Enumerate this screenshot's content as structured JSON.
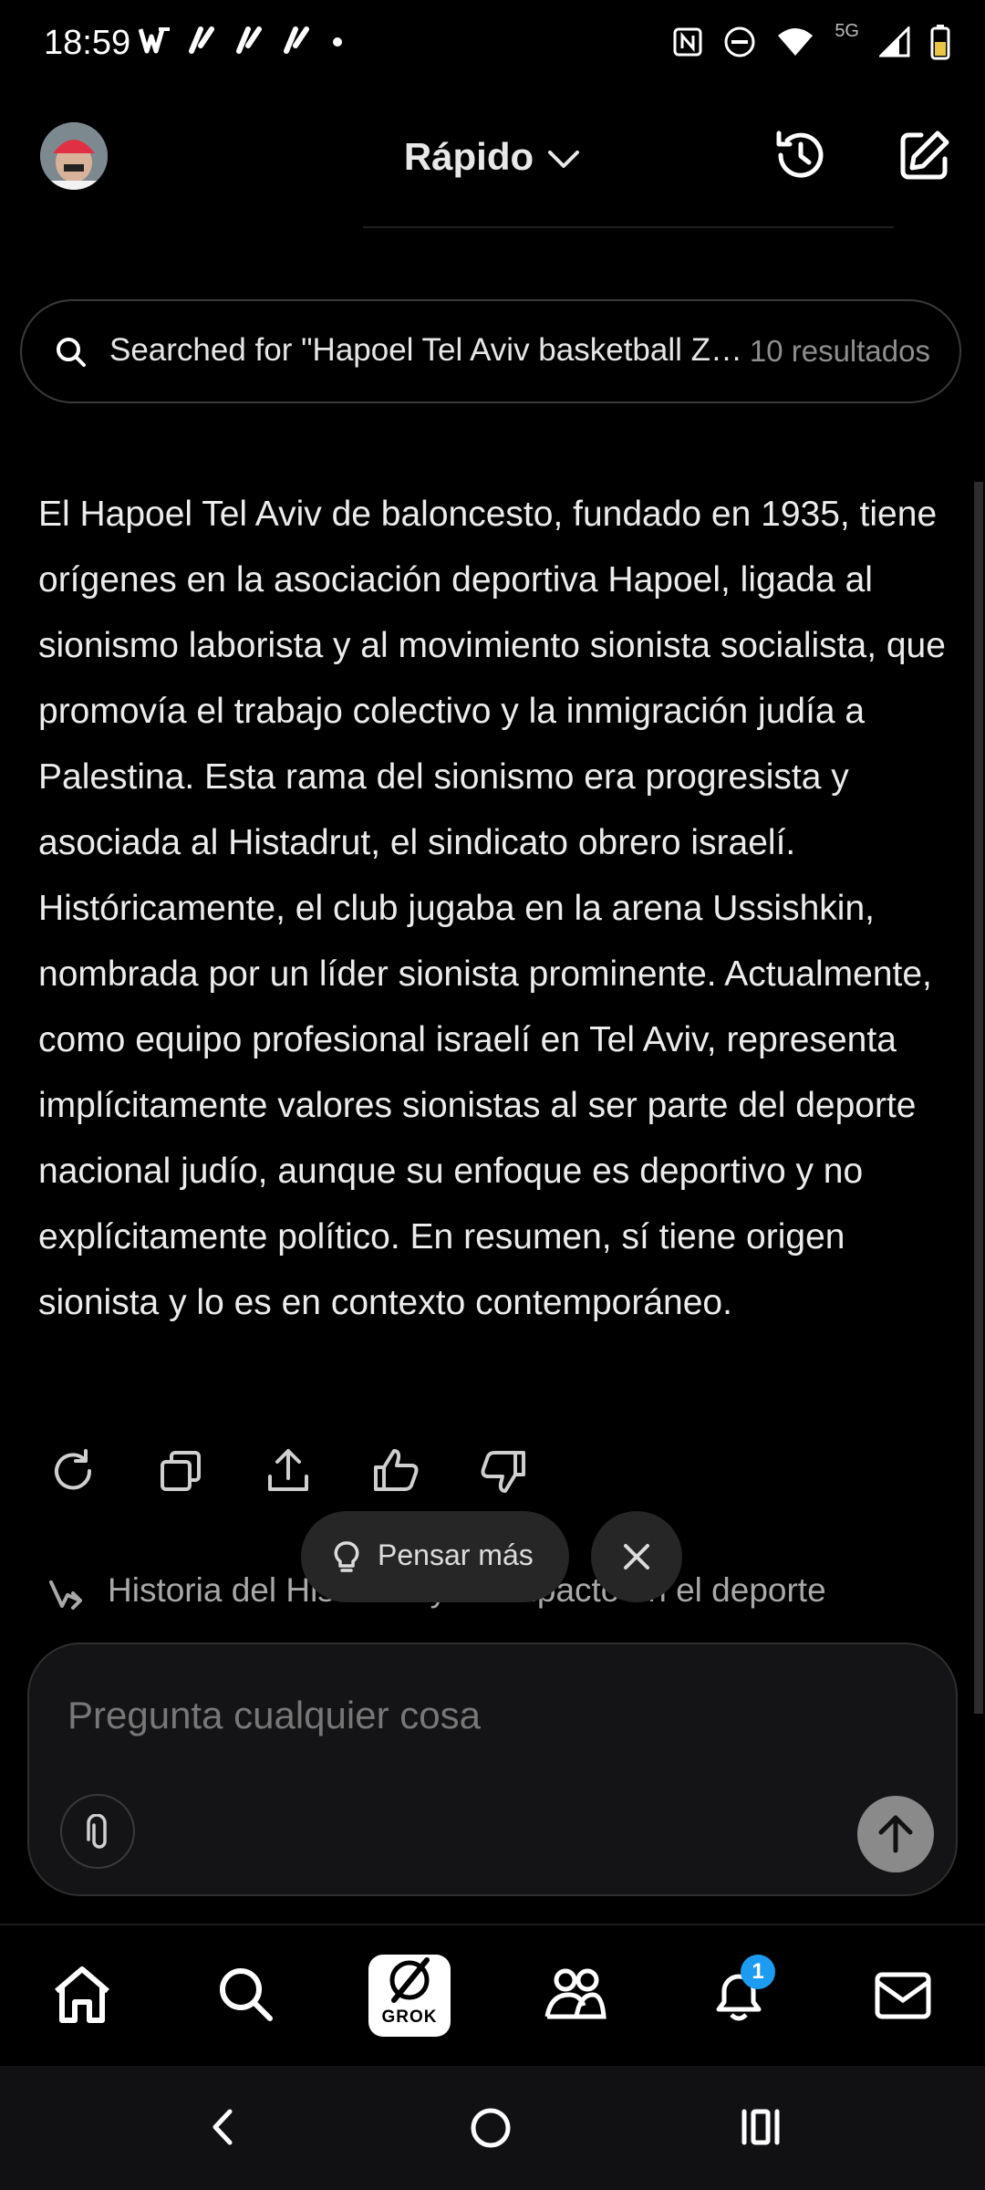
{
  "status_bar": {
    "time": "18:59",
    "network_label": "5G",
    "left_icons": [
      "w-brand-icon",
      "tilde-icon",
      "tilde-icon",
      "tilde-icon",
      "dot-icon"
    ],
    "right_icons": [
      "nfc-icon",
      "dnd-icon",
      "wifi-icon",
      "signal-icon",
      "battery-icon"
    ]
  },
  "header": {
    "model_label": "Rápido",
    "history_icon": "history-icon",
    "new_chat_icon": "edit-icon"
  },
  "search_result": {
    "query": "Searched for \"Hapoel Tel Aviv basketball Zionism\"",
    "count": "10 resultados"
  },
  "response": {
    "text": "El Hapoel Tel Aviv de baloncesto, fundado en 1935, tiene orígenes en la asociación deportiva Hapoel, ligada al sionismo laborista y al movimiento sionista socialista, que promovía el trabajo colectivo y la inmigración judía a Palestina. Esta rama del sionismo era progresista y asociada al Histadrut, el sindicato obrero israelí. Históricamente, el club jugaba en la arena Ussishkin, nombrada por un líder sionista prominente. Actualmente, como equipo profesional israelí en Tel Aviv, representa implícitamente valores sionistas al ser parte del deporte nacional judío, aunque su enfoque es deportivo y no explícitamente político. En resumen, sí tiene origen sionista y lo es en contexto contemporáneo."
  },
  "actions": [
    "regenerate-icon",
    "copy-icon",
    "share-icon",
    "thumbs-up-icon",
    "thumbs-down-icon"
  ],
  "chips": {
    "think_more": "Pensar más"
  },
  "followup": {
    "text": "Historia del Histadrut y su impacto en el deporte"
  },
  "composer": {
    "placeholder": "Pregunta cualquier cosa"
  },
  "bottom_nav": {
    "items": [
      "home-icon",
      "search-icon",
      "grok-icon",
      "communities-icon",
      "notifications-icon",
      "messages-icon"
    ],
    "grok_label": "GROK",
    "notification_badge": "1"
  },
  "colors": {
    "background": "#000000",
    "text": "#ececec",
    "muted": "#8e8e8e",
    "badge": "#1d9bf0",
    "composer_bg": "#141416"
  }
}
